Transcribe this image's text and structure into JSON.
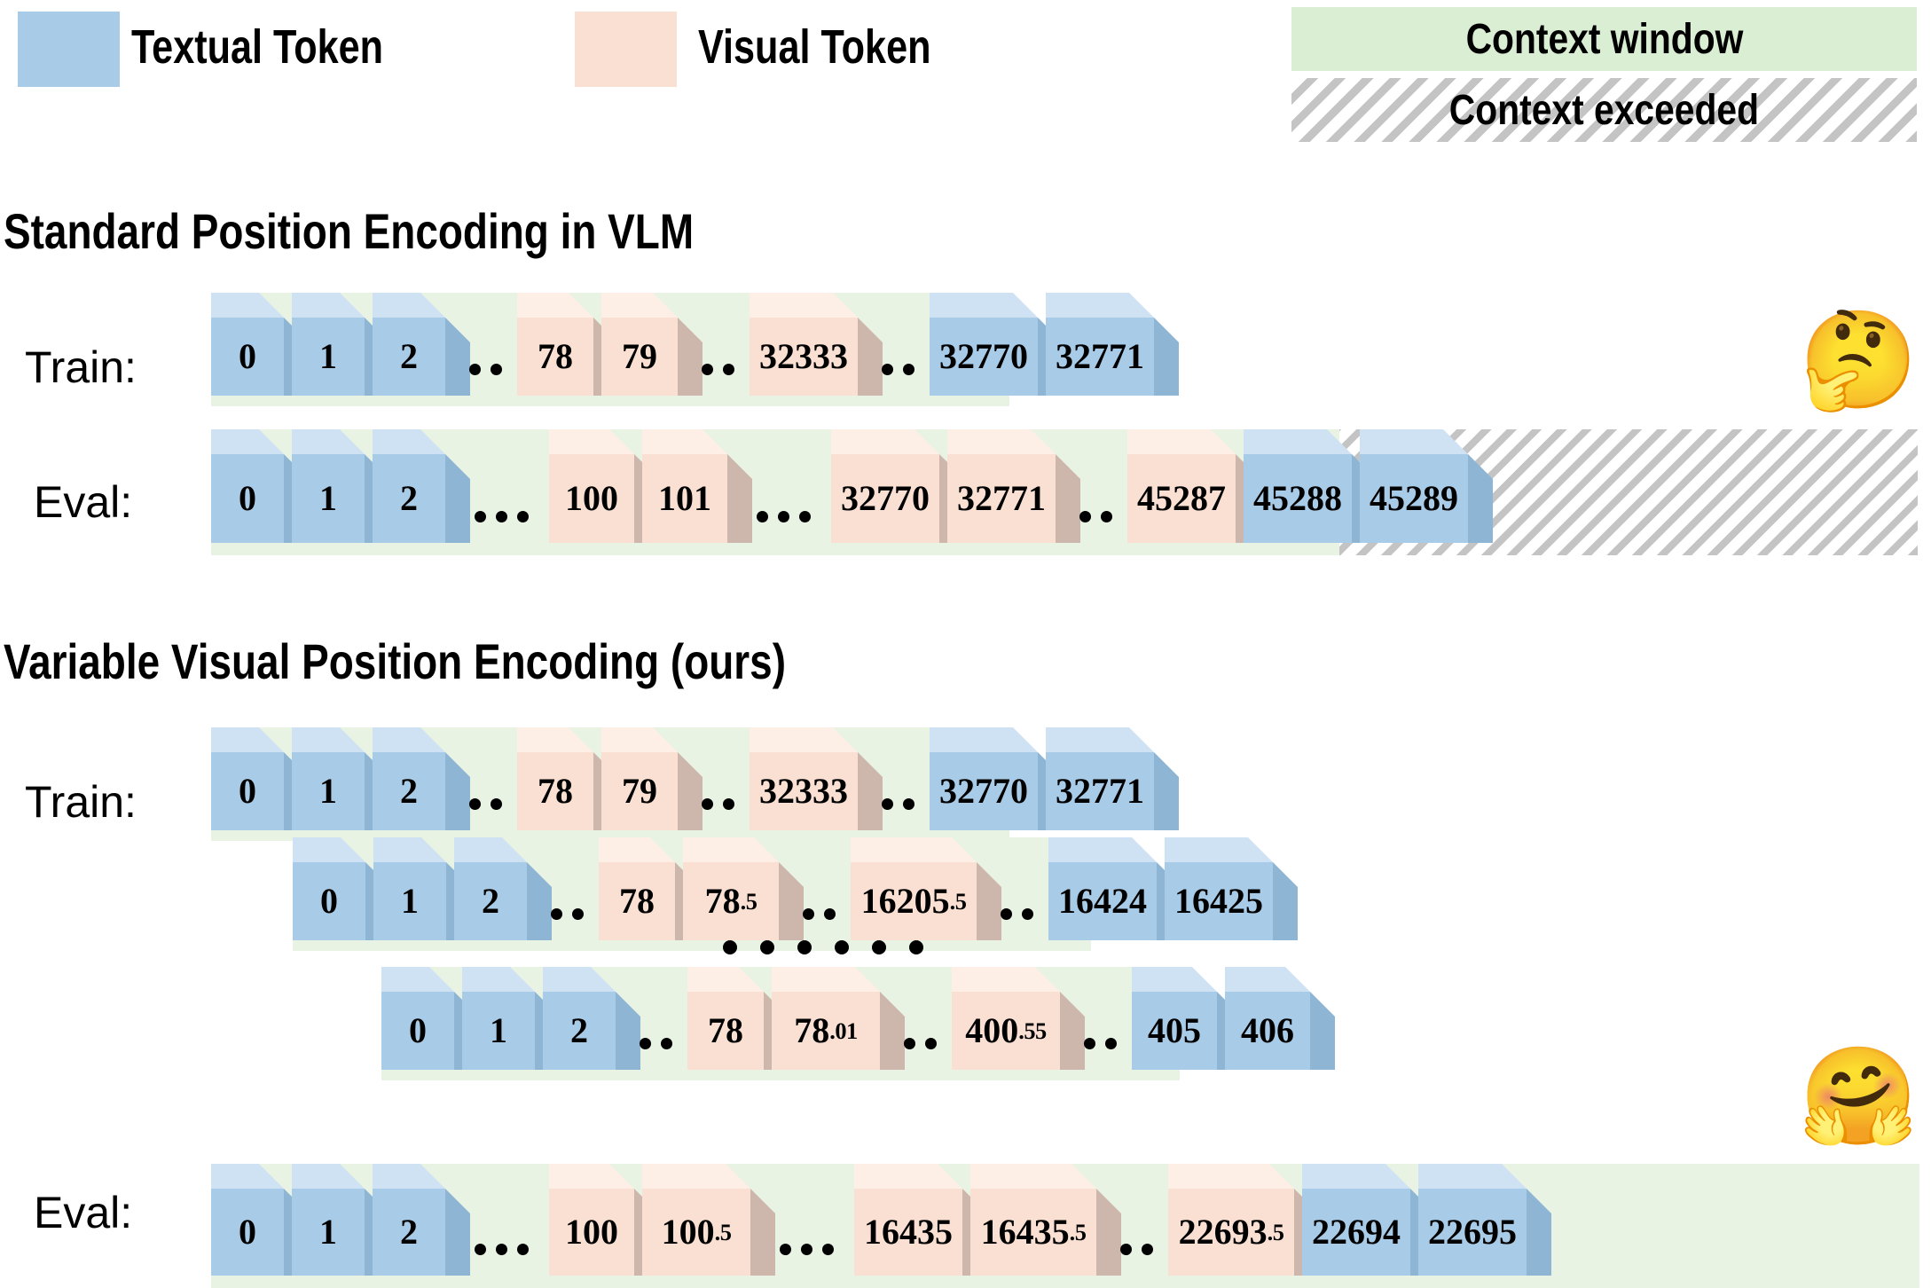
{
  "legend": {
    "textual_token": "Textual Token",
    "visual_token": "Visual Token",
    "context_window": "Context window",
    "context_exceeded": "Context exceeded",
    "colors": {
      "textual_token": "#a8cbe8",
      "visual_token": "#fae0d2",
      "context_window": "#e8f3e3",
      "context_exceeded": "#c4c4c4"
    }
  },
  "sections": [
    {
      "id": "standard",
      "title": "Standard Position Encoding in VLM",
      "rows": [
        {
          "label": "Train:",
          "cells": [
            {
              "type": "cube",
              "kind": "textual",
              "value": "0"
            },
            {
              "type": "cube",
              "kind": "textual",
              "value": "1"
            },
            {
              "type": "cube",
              "kind": "textual",
              "value": "2"
            },
            {
              "type": "dots",
              "count": 2
            },
            {
              "type": "cube",
              "kind": "visual",
              "value": "78"
            },
            {
              "type": "cube",
              "kind": "visual",
              "value": "79"
            },
            {
              "type": "dots",
              "count": 2
            },
            {
              "type": "cube",
              "kind": "visual",
              "value": "32333"
            },
            {
              "type": "dots",
              "count": 2
            },
            {
              "type": "cube",
              "kind": "textual",
              "value": "32770"
            },
            {
              "type": "cube",
              "kind": "textual",
              "value": "32771"
            }
          ]
        },
        {
          "label": "Eval:",
          "cells": [
            {
              "type": "cube",
              "kind": "textual",
              "value": "0"
            },
            {
              "type": "cube",
              "kind": "textual",
              "value": "1"
            },
            {
              "type": "cube",
              "kind": "textual",
              "value": "2"
            },
            {
              "type": "dots",
              "count": 3
            },
            {
              "type": "cube",
              "kind": "visual",
              "value": "100"
            },
            {
              "type": "cube",
              "kind": "visual",
              "value": "101"
            },
            {
              "type": "dots",
              "count": 3
            },
            {
              "type": "cube",
              "kind": "visual",
              "value": "32770"
            },
            {
              "type": "cube",
              "kind": "visual",
              "value": "32771"
            },
            {
              "type": "dots",
              "count": 2
            },
            {
              "type": "cube",
              "kind": "visual",
              "value": "45287"
            },
            {
              "type": "cube",
              "kind": "textual",
              "value": "45288"
            },
            {
              "type": "cube",
              "kind": "textual",
              "value": "45289"
            }
          ]
        }
      ]
    },
    {
      "id": "ours",
      "title": "Variable Visual Position Encoding (ours)",
      "rows": [
        {
          "label": "Train:",
          "cells": [
            {
              "type": "cube",
              "kind": "textual",
              "value": "0"
            },
            {
              "type": "cube",
              "kind": "textual",
              "value": "1"
            },
            {
              "type": "cube",
              "kind": "textual",
              "value": "2"
            },
            {
              "type": "dots",
              "count": 2
            },
            {
              "type": "cube",
              "kind": "visual",
              "value": "78"
            },
            {
              "type": "cube",
              "kind": "visual",
              "value": "79"
            },
            {
              "type": "dots",
              "count": 2
            },
            {
              "type": "cube",
              "kind": "visual",
              "value": "32333"
            },
            {
              "type": "dots",
              "count": 2
            },
            {
              "type": "cube",
              "kind": "textual",
              "value": "32770"
            },
            {
              "type": "cube",
              "kind": "textual",
              "value": "32771"
            }
          ]
        },
        {
          "label": "",
          "cells": [
            {
              "type": "cube",
              "kind": "textual",
              "value": "0"
            },
            {
              "type": "cube",
              "kind": "textual",
              "value": "1"
            },
            {
              "type": "cube",
              "kind": "textual",
              "value": "2"
            },
            {
              "type": "dots",
              "count": 2
            },
            {
              "type": "cube",
              "kind": "visual",
              "value": "78"
            },
            {
              "type": "cube",
              "kind": "visual",
              "value": "78",
              "sub": ".5"
            },
            {
              "type": "dots",
              "count": 2
            },
            {
              "type": "cube",
              "kind": "visual",
              "value": "16205",
              "sub": ".5"
            },
            {
              "type": "dots",
              "count": 2
            },
            {
              "type": "cube",
              "kind": "textual",
              "value": "16424"
            },
            {
              "type": "cube",
              "kind": "textual",
              "value": "16425"
            }
          ]
        },
        {
          "label": "",
          "cells": [
            {
              "type": "cube",
              "kind": "textual",
              "value": "0"
            },
            {
              "type": "cube",
              "kind": "textual",
              "value": "1"
            },
            {
              "type": "cube",
              "kind": "textual",
              "value": "2"
            },
            {
              "type": "dots",
              "count": 2
            },
            {
              "type": "cube",
              "kind": "visual",
              "value": "78"
            },
            {
              "type": "cube",
              "kind": "visual",
              "value": "78",
              "sub": ".01"
            },
            {
              "type": "dots",
              "count": 2
            },
            {
              "type": "cube",
              "kind": "visual",
              "value": "400",
              "sub": ".55"
            },
            {
              "type": "dots",
              "count": 2
            },
            {
              "type": "cube",
              "kind": "textual",
              "value": "405"
            },
            {
              "type": "cube",
              "kind": "textual",
              "value": "406"
            }
          ]
        },
        {
          "label": "Eval:",
          "cells": [
            {
              "type": "cube",
              "kind": "textual",
              "value": "0"
            },
            {
              "type": "cube",
              "kind": "textual",
              "value": "1"
            },
            {
              "type": "cube",
              "kind": "textual",
              "value": "2"
            },
            {
              "type": "dots",
              "count": 3
            },
            {
              "type": "cube",
              "kind": "visual",
              "value": "100"
            },
            {
              "type": "cube",
              "kind": "visual",
              "value": "100",
              "sub": ".5"
            },
            {
              "type": "dots",
              "count": 3
            },
            {
              "type": "cube",
              "kind": "visual",
              "value": "16435"
            },
            {
              "type": "cube",
              "kind": "visual",
              "value": "16435",
              "sub": ".5"
            },
            {
              "type": "dots",
              "count": 2
            },
            {
              "type": "cube",
              "kind": "visual",
              "value": "22693",
              "sub": ".5"
            },
            {
              "type": "cube",
              "kind": "textual",
              "value": "22694"
            },
            {
              "type": "cube",
              "kind": "textual",
              "value": "22695"
            }
          ]
        }
      ]
    }
  ],
  "vertical_ellipsis": "• • • • • •",
  "emojis": {
    "thinking": "🤔",
    "hugging": "🤗"
  }
}
